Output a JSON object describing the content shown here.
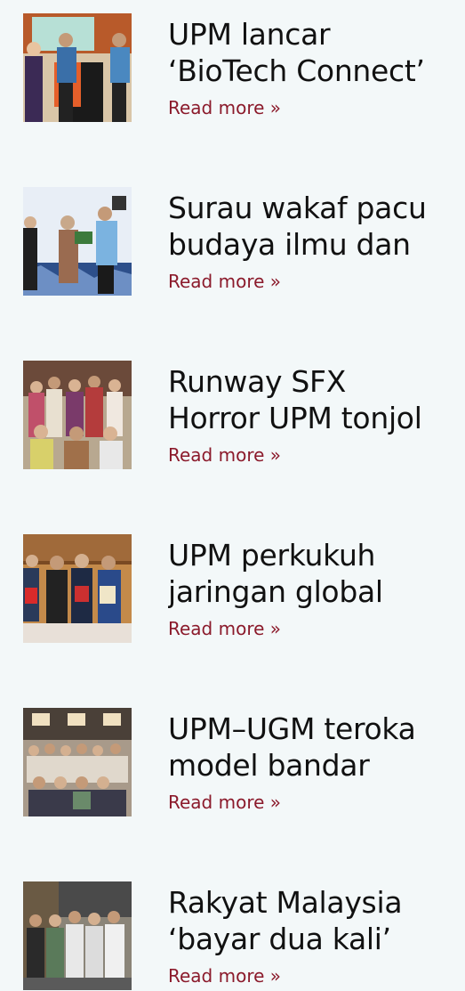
{
  "articles": [
    {
      "title_lines": [
        "UPM lancar",
        "‘BioTech Connect’"
      ],
      "read_more": "Read more »",
      "image": "photo-launch-ceremony"
    },
    {
      "title_lines": [
        "Surau wakaf pacu",
        "budaya ilmu dan"
      ],
      "read_more": "Read more »",
      "image": "photo-certificate-handover"
    },
    {
      "title_lines": [
        "Runway SFX",
        "Horror UPM tonjol"
      ],
      "read_more": "Read more »",
      "image": "photo-group-costumes"
    },
    {
      "title_lines": [
        "UPM perkukuh",
        "jaringan global"
      ],
      "read_more": "Read more »",
      "image": "photo-delegation-gifts"
    },
    {
      "title_lines": [
        "UPM–UGM teroka",
        "model bandar"
      ],
      "read_more": "Read more »",
      "image": "photo-group-seminar"
    },
    {
      "title_lines": [
        "Rakyat Malaysia",
        "‘bayar dua kali’"
      ],
      "read_more": "Read more »",
      "image": "photo-group-visit"
    }
  ],
  "colors": {
    "background": "#f3f8f9",
    "title": "#111111",
    "link": "#8b1a2b"
  }
}
